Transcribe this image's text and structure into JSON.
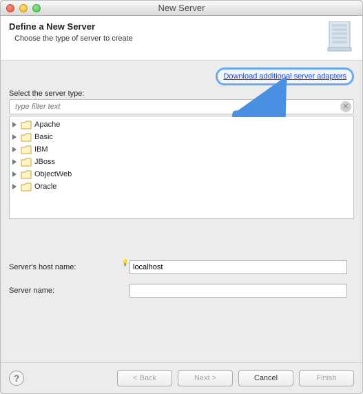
{
  "window": {
    "title": "New Server"
  },
  "header": {
    "title": "Define a New Server",
    "subtitle": "Choose the type of server to create"
  },
  "body": {
    "download_link": "Download additional server adapters",
    "select_label": "Select the server type:",
    "filter_placeholder": "type filter text",
    "tree_items": [
      "Apache",
      "Basic",
      "IBM",
      "JBoss",
      "ObjectWeb",
      "Oracle"
    ]
  },
  "form": {
    "hostname_label": "Server's host name:",
    "hostname_value": "localhost",
    "servername_label": "Server name:",
    "servername_value": ""
  },
  "buttons": {
    "back": "< Back",
    "next": "Next >",
    "cancel": "Cancel",
    "finish": "Finish"
  }
}
